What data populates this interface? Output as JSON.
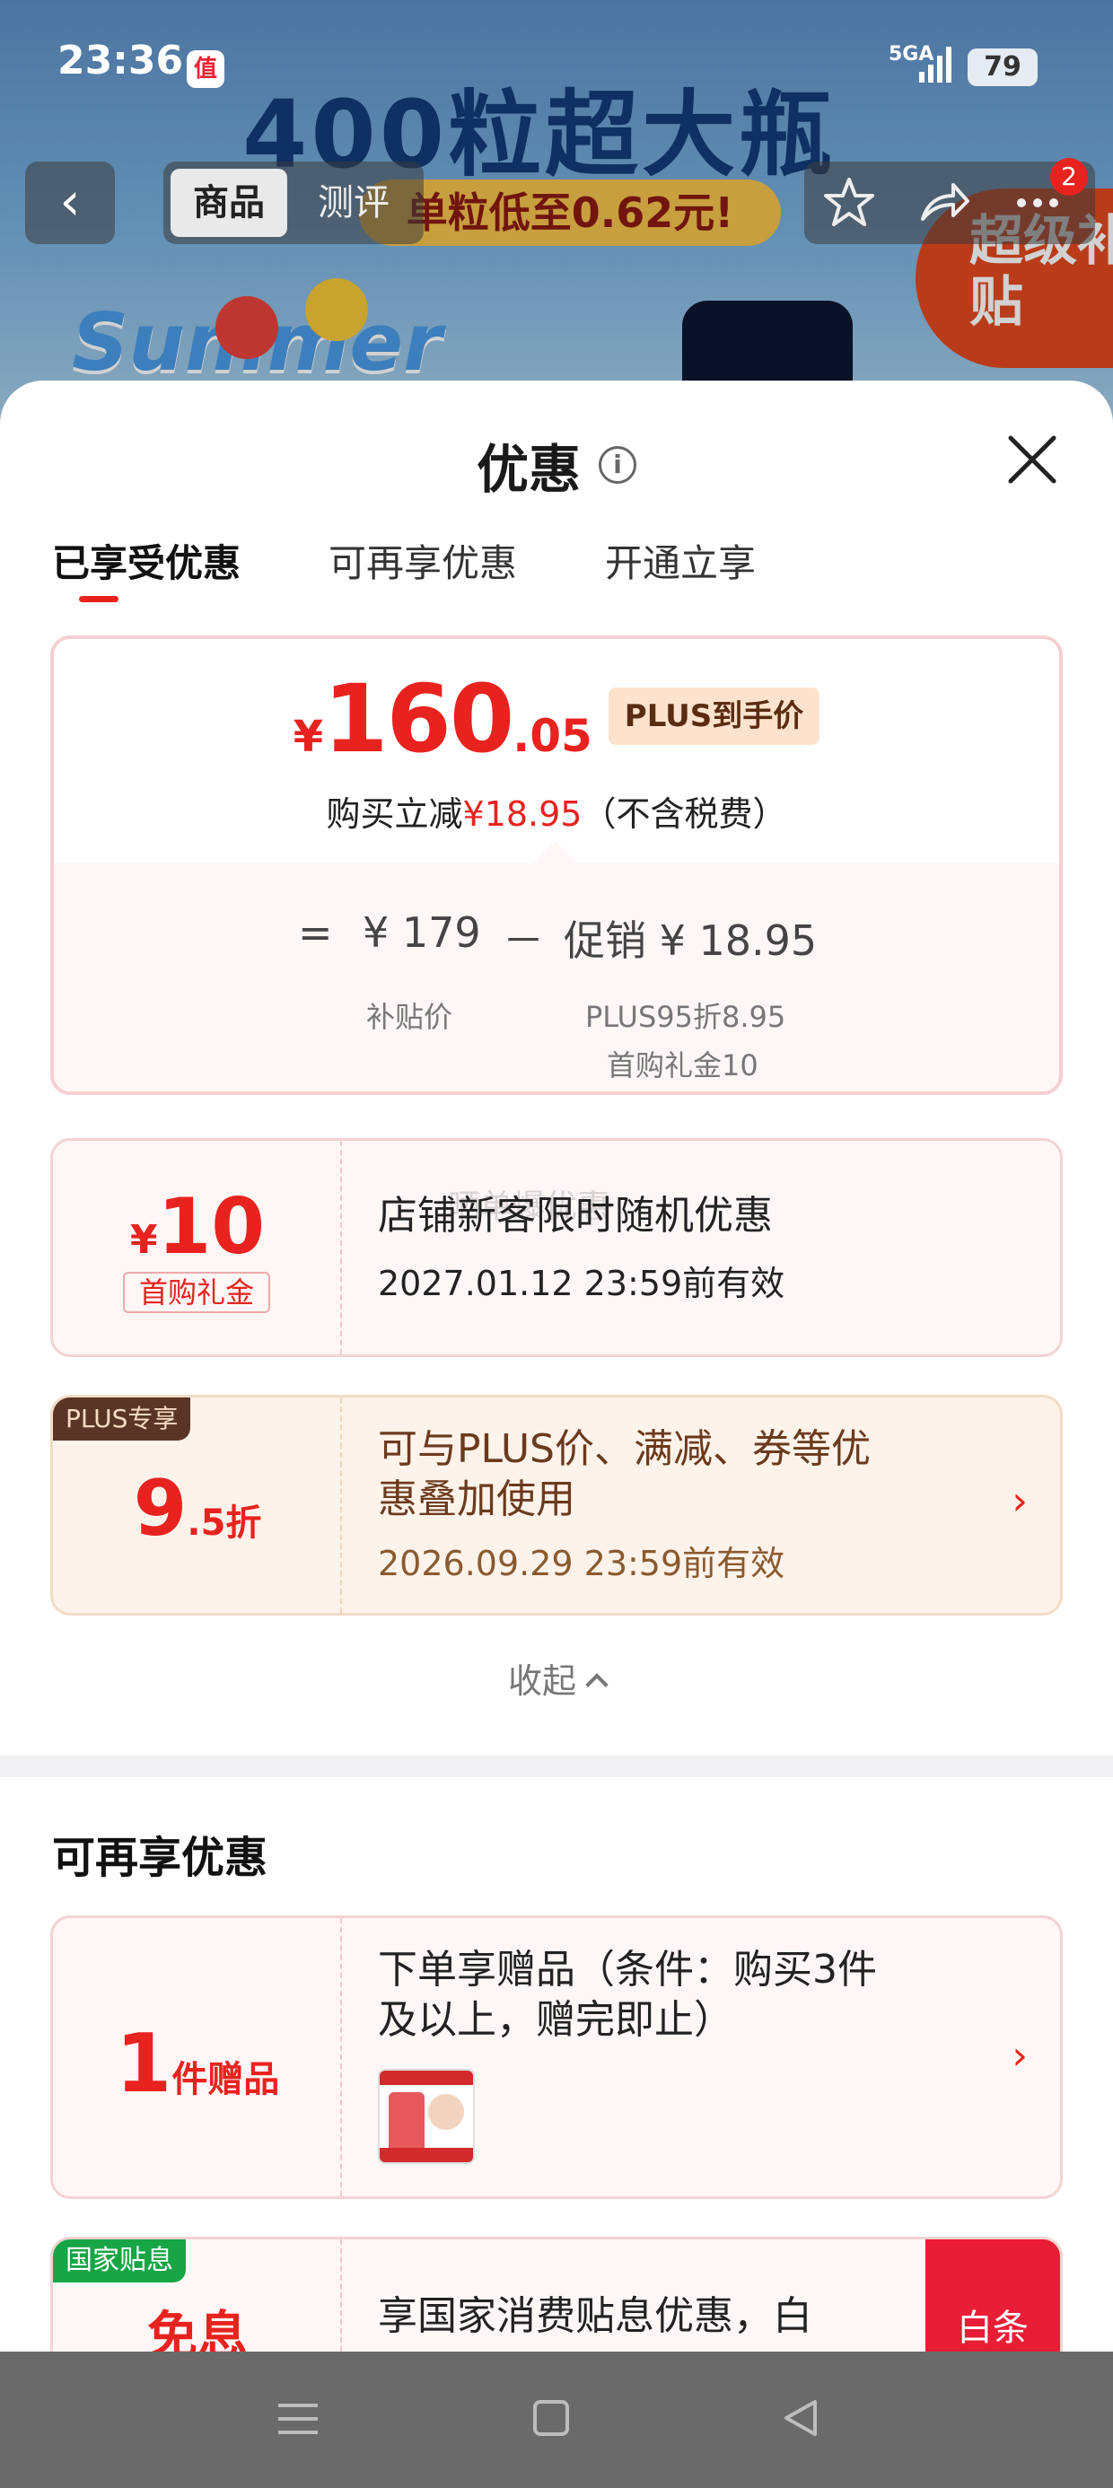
{
  "status_bar": {
    "time": "23:36",
    "app_badge": "值",
    "network": "5GA",
    "battery": "79"
  },
  "background": {
    "banner_text": "400粒超大瓶",
    "banner_sub": "单粒低至0.62元!",
    "summer_text": "Summer",
    "super_subsidy": "超级补贴",
    "nav": {
      "tab_goods": "商品",
      "tab_review": "测评",
      "badge_count": "2"
    }
  },
  "sheet": {
    "title": "优惠",
    "tabs": [
      "已享受优惠",
      "可再享优惠",
      "开通立享"
    ],
    "active_tab": 0,
    "summary": {
      "currency": "¥",
      "price_int": "160",
      "price_dec": ".05",
      "price_tag": "PLUS到手价",
      "reduce_prefix": "购买立减",
      "reduce_amount": "¥18.95",
      "reduce_suffix": "（不含税费）",
      "eq": "=",
      "base_price": "¥ 179",
      "minus": "－",
      "promo": "促销 ¥ 18.95",
      "base_label": "补贴价",
      "promo_detail_1": "PLUS95折8.95",
      "promo_detail_2": "首购礼金10"
    },
    "coupons": [
      {
        "currency": "¥",
        "amount": "10",
        "tag": "首购礼金",
        "desc": "店铺新客限时随机优惠",
        "valid": "2027.01.12 23:59前有效",
        "watermark": "晒单爆优惠"
      },
      {
        "badge": "PLUS专享",
        "amount_big": "9",
        "amount_small": ".5折",
        "desc_line1": "可与PLUS价、满减、券等优",
        "desc_line2": "惠叠加使用",
        "valid": "2026.09.29 23:59前有效",
        "arrow": "›"
      }
    ],
    "collapse": "收起",
    "more_section_title": "可再享优惠",
    "more_coupons": [
      {
        "amount_big": "1",
        "amount_small": "件赠品",
        "desc_line1": "下单享赠品（条件：购买3件",
        "desc_line2": "及以上，赠完即止）",
        "arrow": "›"
      },
      {
        "badge": "国家贴息",
        "amount": "免息",
        "desc_line1": "享国家消费贴息优惠，白",
        "side": "白条"
      }
    ]
  },
  "colors": {
    "accent": "#e8231f",
    "plus_brown": "#5a3525",
    "national_green": "#17a546"
  }
}
